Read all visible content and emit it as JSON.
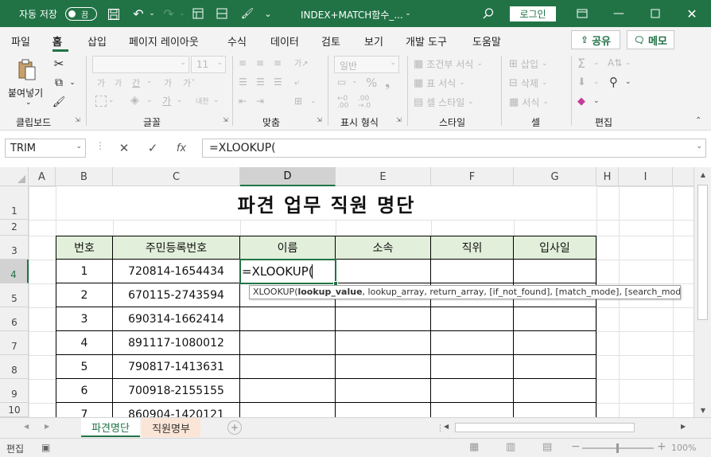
{
  "title_bar": {
    "autosave_label": "자동 저장",
    "autosave_state": "끔",
    "file_name": "INDEX+MATCH함수_...",
    "login_label": "로그인"
  },
  "menu": {
    "tabs": [
      "파일",
      "홈",
      "삽입",
      "페이지 레이아웃",
      "수식",
      "데이터",
      "검토",
      "보기",
      "개발 도구",
      "도움말"
    ],
    "active_tab": "홈",
    "share_label": "공유",
    "memo_label": "메모"
  },
  "ribbon": {
    "clipboard": {
      "paste_label": "붙여넣기",
      "group_label": "클립보드"
    },
    "font": {
      "font_size": "11",
      "group_label": "글꼴"
    },
    "align": {
      "group_label": "맞춤"
    },
    "number": {
      "format": "일반",
      "group_label": "표시 형식"
    },
    "styles": {
      "conditional": "조건부 서식",
      "table": "표 서식",
      "cell_style": "셀 스타일",
      "group_label": "스타일"
    },
    "cells": {
      "insert": "삽입",
      "delete": "삭제",
      "format": "서식",
      "group_label": "셀"
    },
    "editing": {
      "group_label": "편집"
    }
  },
  "formula_bar": {
    "name_box": "TRIM",
    "formula": "=XLOOKUP("
  },
  "grid": {
    "columns": [
      "A",
      "B",
      "C",
      "D",
      "E",
      "F",
      "G",
      "H",
      "I"
    ],
    "rows": [
      "1",
      "2",
      "3",
      "4",
      "5",
      "6",
      "7",
      "8",
      "9",
      "10"
    ],
    "title": "파견 업무 직원 명단",
    "headers": [
      "번호",
      "주민등록번호",
      "이름",
      "소속",
      "직위",
      "입사일"
    ],
    "data": [
      [
        "1",
        "720814-1654434"
      ],
      [
        "2",
        "670115-2743594"
      ],
      [
        "3",
        "690314-1662414"
      ],
      [
        "4",
        "891117-1080012"
      ],
      [
        "5",
        "790817-1413631"
      ],
      [
        "6",
        "700918-2155155"
      ],
      [
        "7",
        "860904-1420121"
      ]
    ],
    "editing_text": "=XLOOKUP(",
    "tooltip": {
      "func": "XLOOKUP(",
      "bold_arg": "lookup_value",
      "rest": ", lookup_array, return_array, [if_not_found], [match_mode], [search_mode])"
    }
  },
  "sheets": {
    "tabs": [
      "파견명단",
      "직원명부"
    ],
    "active": "파견명단"
  },
  "status_bar": {
    "mode": "편집",
    "zoom": "100%"
  }
}
